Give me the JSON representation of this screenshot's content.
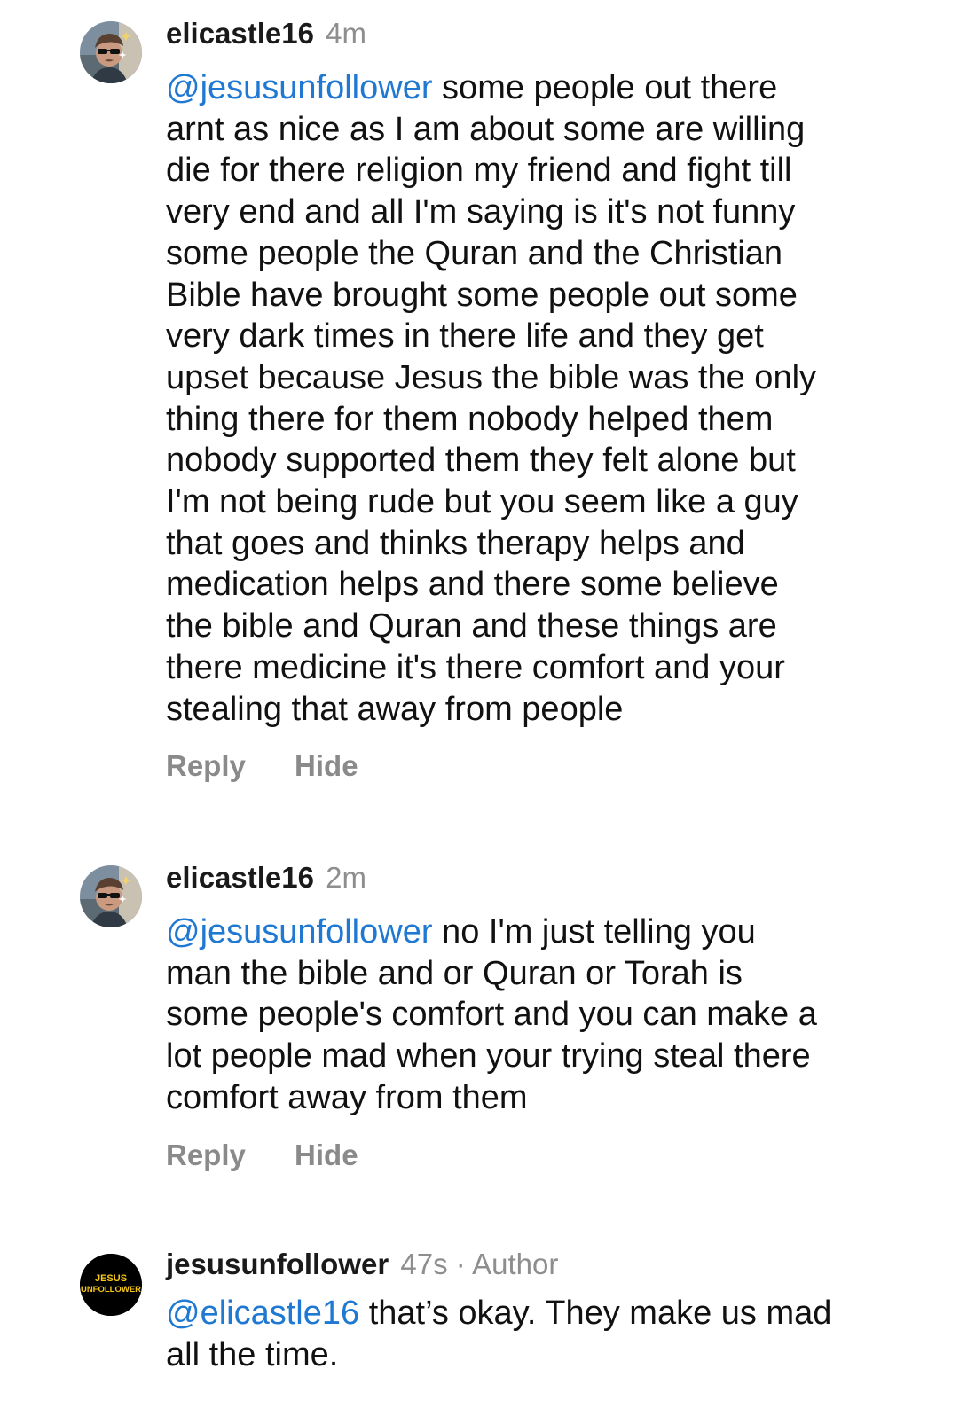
{
  "comments": [
    {
      "username": "elicastle16",
      "time": "4m",
      "mention": "@jesusunfollower",
      "text": " some people out there\narnt as nice as I am about some are willing\ndie for there religion my friend and fight till\nvery end and all I'm saying is it's not funny\nsome people the Quran and the Christian\nBible have brought some people out some\nvery dark times in there life and they get\nupset because Jesus the bible was the only\nthing there for them nobody helped them\nnobody supported them they felt alone but\nI'm not being rude but you seem like a guy\nthat goes and thinks therapy helps and\nmedication helps and there some believe\nthe bible and Quran and these things are\nthere medicine it's there comfort and your\nstealing that away from people",
      "reply_label": "Reply",
      "hide_label": "Hide"
    },
    {
      "username": "elicastle16",
      "time": "2m",
      "mention": "@jesusunfollower",
      "text": " no I'm just telling you\nman the bible and or Quran or Torah is\nsome people's comfort and you can make a\nlot people mad when your trying steal there\ncomfort away from them",
      "reply_label": "Reply",
      "hide_label": "Hide"
    },
    {
      "username": "jesusunfollower",
      "time": "47s",
      "separator": "·",
      "badge": "Author",
      "mention": "@elicastle16",
      "text": " that’s okay. They make us mad\nall the time.",
      "avatar_logo_line1": "JESUS",
      "avatar_logo_line2": "UNFOLLOWER"
    }
  ],
  "colors": {
    "mention": "#1f78d1",
    "muted": "#8e8e8e",
    "action": "#8a8a8a",
    "logo_yellow": "#f5c518",
    "logo_red": "#e0352b"
  },
  "icons": {
    "user_avatar": "profile-photo-icon",
    "author_avatar": "jesus-unfollower-logo"
  }
}
